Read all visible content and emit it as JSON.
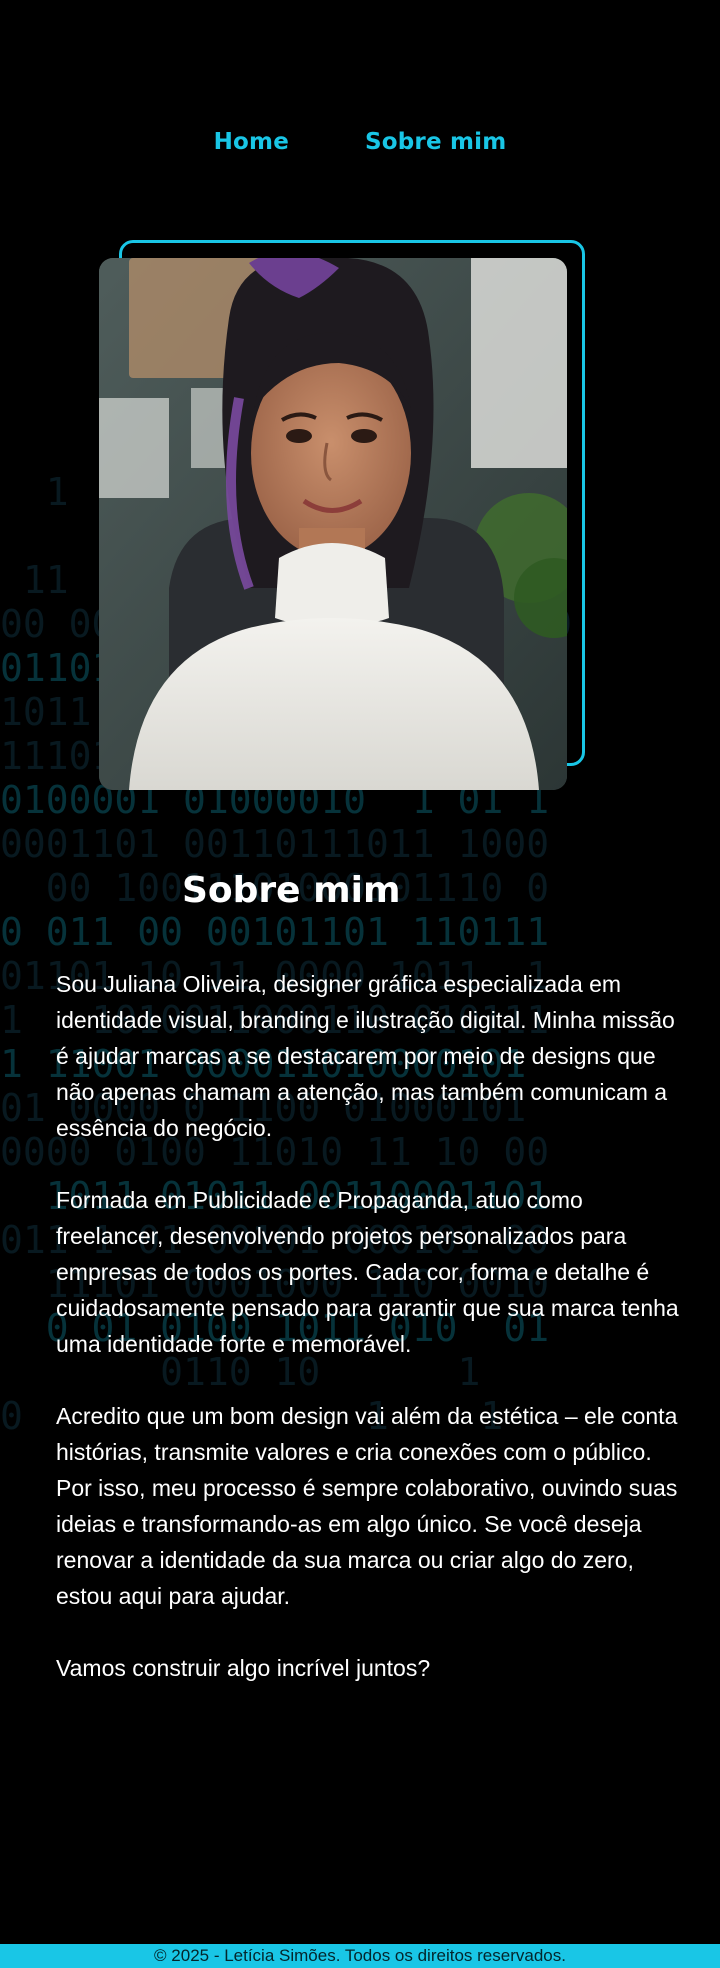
{
  "nav": {
    "home_label": "Home",
    "about_label": "Sobre mim"
  },
  "about": {
    "title": "Sobre mim",
    "photo_alt": "Foto de Juliana Oliveira",
    "paragraphs": [
      "Sou Juliana Oliveira, designer gráfica especializada em identidade visual, branding e ilustração digital. Minha missão é ajudar marcas a se destacarem por meio de designs que não apenas chamam a atenção, mas também comunicam a essência do negócio.",
      "Formada em Publicidade e Propaganda, atuo como freelancer, desenvolvendo projetos personalizados para empresas de todos os portes. Cada cor, forma e detalhe é cuidadosamente pensado para garantir que sua marca tenha uma identidade forte e memorável.",
      "Acredito que um bom design vai além da estética – ele conta histórias, transmite valores e cria conexões com o público. Por isso, meu processo é sempre colaborativo, ouvindo suas ideias e transformando-as em algo único. Se você deseja renovar a identidade da sua marca ou criar algo do zero, estou aqui para ajudar.",
      "Vamos construir algo incrível juntos?"
    ]
  },
  "background": {
    "binary_rows": [
      "  1                     ",
      "                        ",
      " 11                01011",
      "00 0010       1  10100110",
      "011011   1001 1 00101101",
      "1011 0  1001 0     1  10",
      "11101000010111 001101000",
      "0100001 01000010  1 01 1",
      "0001101 00110111011 1000",
      "  00 10011101000101110 0",
      "0 011 00 00101101 110111",
      "01101 10 11 0000 1011  1",
      "1   1010011000110 010111",
      "1 11001 000011010000101 ",
      "01 0000 0 1100 01000101 ",
      "0000 0100 11010 11 10 00",
      "  1011 01011 00110001101",
      "011 1 01 00101 000101 00",
      "  11101 0001000 110 0010",
      "  0 01 0100 1011 010  01",
      "       0110 10      1   ",
      "0               1    1  "
    ]
  },
  "footer": {
    "text": "© 2025 - Letícia Simões. Todos os direitos reservados."
  },
  "colors": {
    "accent": "#19c6e6",
    "background": "#000000",
    "text": "#ffffff"
  }
}
